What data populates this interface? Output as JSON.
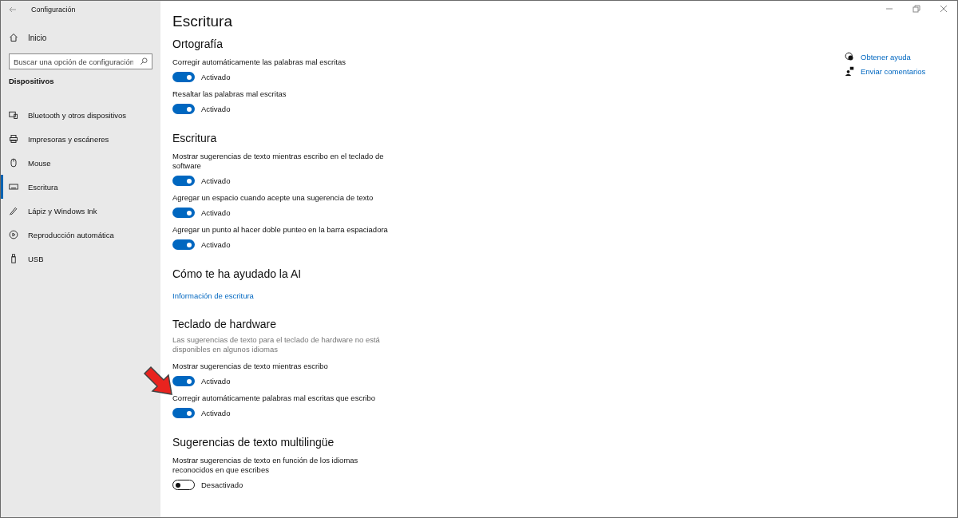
{
  "window": {
    "title": "Configuración"
  },
  "sidebar": {
    "home": "Inicio",
    "search": {
      "placeholder": "Buscar una opción de configuración"
    },
    "section": "Dispositivos",
    "items": [
      {
        "label": "Bluetooth y otros dispositivos",
        "kind": "bluetooth",
        "selected": false
      },
      {
        "label": "Impresoras y escáneres",
        "kind": "printer",
        "selected": false
      },
      {
        "label": "Mouse",
        "kind": "mouse",
        "selected": false
      },
      {
        "label": "Escritura",
        "kind": "keyboard",
        "selected": true
      },
      {
        "label": "Lápiz y Windows Ink",
        "kind": "pen",
        "selected": false
      },
      {
        "label": "Reproducción automática",
        "kind": "autoplay",
        "selected": false
      },
      {
        "label": "USB",
        "kind": "usb",
        "selected": false
      }
    ]
  },
  "page": {
    "title": "Escritura",
    "sections": [
      {
        "heading": "Ortografía",
        "items": [
          {
            "kind": "toggle",
            "label": "Corregir automáticamente las palabras mal escritas",
            "on": true,
            "state": "Activado"
          },
          {
            "kind": "toggle",
            "label": "Resaltar las palabras mal escritas",
            "on": true,
            "state": "Activado"
          }
        ]
      },
      {
        "heading": "Escritura",
        "items": [
          {
            "kind": "toggle",
            "label": "Mostrar sugerencias de texto mientras escribo en el teclado de software",
            "on": true,
            "state": "Activado"
          },
          {
            "kind": "toggle",
            "label": "Agregar un espacio cuando acepte una sugerencia de texto",
            "on": true,
            "state": "Activado"
          },
          {
            "kind": "toggle",
            "label": "Agregar un punto al hacer doble punteo en la barra espaciadora",
            "on": true,
            "state": "Activado"
          }
        ]
      },
      {
        "heading": "Cómo te ha ayudado la AI",
        "items": [
          {
            "kind": "link",
            "label": "Información de escritura"
          }
        ]
      },
      {
        "heading": "Teclado de hardware",
        "items": [
          {
            "kind": "note",
            "label": "Las sugerencias de texto para el teclado de hardware no está disponibles en algunos idiomas"
          },
          {
            "kind": "toggle",
            "label": "Mostrar sugerencias de texto mientras escribo",
            "on": true,
            "state": "Activado"
          },
          {
            "kind": "toggle",
            "label": "Corregir automáticamente palabras mal escritas que escribo",
            "on": true,
            "state": "Activado"
          }
        ]
      },
      {
        "heading": "Sugerencias de texto multilingüe",
        "items": [
          {
            "kind": "toggle",
            "label": "Mostrar sugerencias de texto en función de los idiomas reconocidos en que escribes",
            "on": false,
            "state": "Desactivado"
          }
        ]
      }
    ]
  },
  "help_links": [
    {
      "kind": "help",
      "label": "Obtener ayuda"
    },
    {
      "kind": "feedback",
      "label": "Enviar comentarios"
    }
  ]
}
